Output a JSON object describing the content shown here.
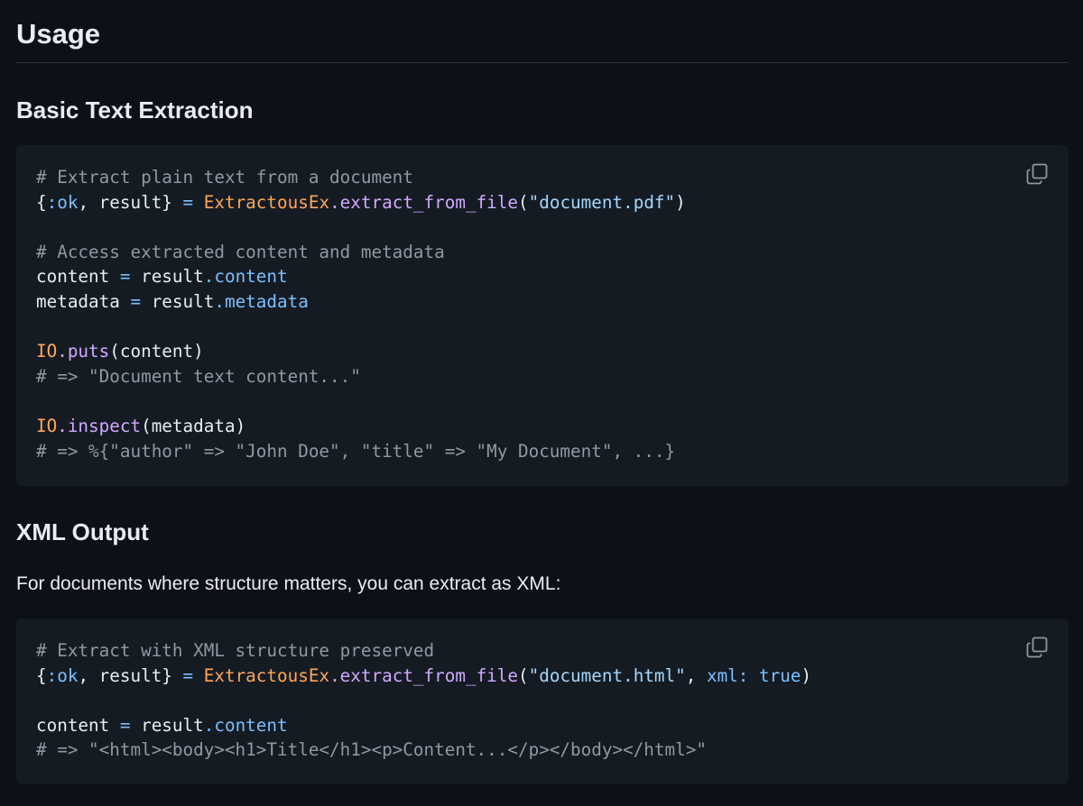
{
  "heading": "Usage",
  "section_basic": {
    "title": "Basic Text Extraction",
    "copy_icon": "copy-icon",
    "code": {
      "l1_comment": "# Extract plain text from a document",
      "l2_open": "{",
      "l2_atom": ":ok",
      "l2_rest": ", result}",
      "l2_eq": "=",
      "l2_mod": "ExtractousEx",
      "l2_fn": ".extract_from_file",
      "l2_paren_open": "(",
      "l2_str": "\"document.pdf\"",
      "l2_paren_close": ")",
      "l4_comment": "# Access extracted content and metadata",
      "l5_var": "content",
      "l5_eq": "=",
      "l5_obj": "result",
      "l5_field": ".content",
      "l6_var": "metadata",
      "l6_eq": "=",
      "l6_obj": "result",
      "l6_field": ".metadata",
      "l8_mod": "IO",
      "l8_fn": ".puts",
      "l8_args": "(content)",
      "l9_comment": "# => \"Document text content...\"",
      "l11_mod": "IO",
      "l11_fn": ".inspect",
      "l11_args": "(metadata)",
      "l12_comment": "# => %{\"author\" => \"John Doe\", \"title\" => \"My Document\", ...}"
    }
  },
  "section_xml": {
    "title": "XML Output",
    "description": "For documents where structure matters, you can extract as XML:",
    "copy_icon": "copy-icon",
    "code": {
      "l1_comment": "# Extract with XML structure preserved",
      "l2_open": "{",
      "l2_atom": ":ok",
      "l2_rest": ", result}",
      "l2_eq": "=",
      "l2_mod": "ExtractousEx",
      "l2_fn": ".extract_from_file",
      "l2_paren_open": "(",
      "l2_str": "\"document.html\"",
      "l2_comma": ", ",
      "l2_kw": "xml:",
      "l2_bool": "true",
      "l2_paren_close": ")",
      "l4_var": "content",
      "l4_eq": "=",
      "l4_obj": "result",
      "l4_field": ".content",
      "l5_comment": "# => \"<html><body><h1>Title</h1><p>Content...</p></body></html>\""
    }
  },
  "colors": {
    "background": "#0d1117",
    "code_background": "#151b23",
    "comment": "#9198a1",
    "module": "#ffa657",
    "function": "#d2a8ff",
    "string": "#a5d6ff",
    "operator": "#79c0ff"
  }
}
